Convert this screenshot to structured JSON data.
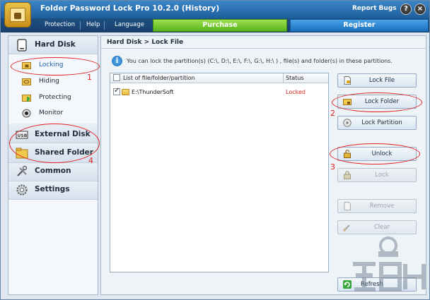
{
  "window": {
    "title": "Folder Password Lock Pro 10.2.0 (History)",
    "report_bugs": "Report Bugs",
    "help_symbol": "?",
    "close_symbol": "×"
  },
  "menu": {
    "items": [
      "Protection",
      "Help",
      "Language"
    ],
    "purchase": "Purchase",
    "register": "Register"
  },
  "sidebar": {
    "hard_disk": "Hard Disk",
    "sub_items": [
      "Locking",
      "Hiding",
      "Protecting",
      "Monitor"
    ],
    "external_disk": "External Disk",
    "shared_folder": "Shared Folder",
    "common": "Common",
    "settings": "Settings",
    "usb_label": "USB"
  },
  "main": {
    "breadcrumb": "Hard Disk > Lock File",
    "info_symbol": "i",
    "info_text": "You can lock the partition(s) (C:\\, D:\\, E:\\, F:\\, G:\\, H:\\ ) , file(s) and folder(s) in these partitions.",
    "list_header": {
      "col1": "List of file/folder/partition",
      "col2": "Status"
    },
    "rows": [
      {
        "path": "E:\\ThunderSoft",
        "status": "Locked",
        "checked": true
      }
    ],
    "refresh": "Refresh"
  },
  "actions": {
    "lock_file": "Lock File",
    "lock_folder": "Lock Folder",
    "lock_partition": "Lock Partition",
    "unlock": "Unlock",
    "lock": "Lock",
    "remove": "Remove",
    "clear": "Clear"
  },
  "annotations": [
    "1",
    "2",
    "3",
    "4"
  ],
  "colors": {
    "title_bar": "#1d5e9c",
    "purchase": "#58b51d",
    "register": "#1b6fbd",
    "locked_status": "#d9221c",
    "annotation": "#e02020"
  }
}
